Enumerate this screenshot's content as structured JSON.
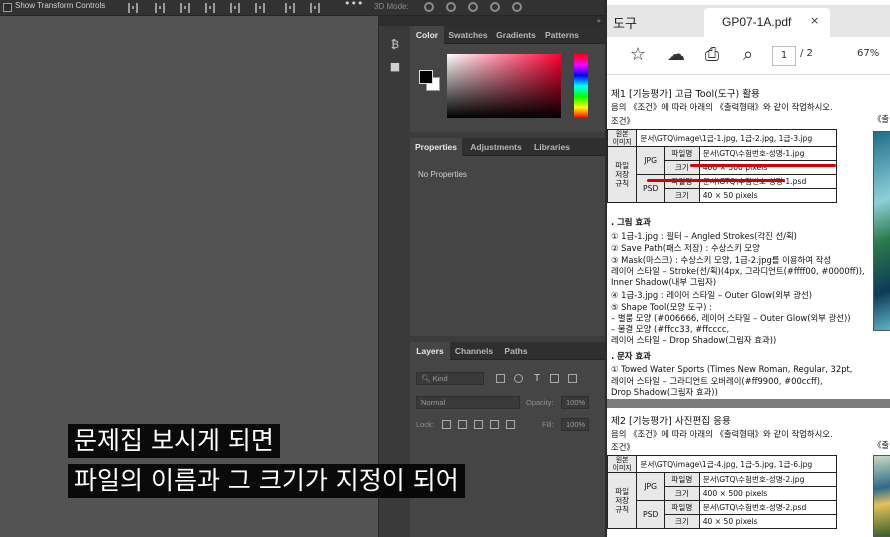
{
  "photoshop": {
    "options_bar": {
      "show_transform_label": "Show Transform Controls",
      "more": "•••",
      "mode_label": "3D Mode:"
    },
    "color_panel": {
      "tabs": [
        "Color",
        "Swatches",
        "Gradients",
        "Patterns"
      ],
      "foreground": "#000000",
      "background": "#ffffff"
    },
    "properties_panel": {
      "tabs": [
        "Properties",
        "Adjustments",
        "Libraries"
      ],
      "empty_text": "No Properties"
    },
    "layers_panel": {
      "tabs": [
        "Layers",
        "Channels",
        "Paths"
      ],
      "kind_label": "Kind",
      "blend_mode": "Normal",
      "opacity_label": "Opacity:",
      "opacity_value": "100%",
      "lock_label": "Lock:",
      "fill_label": "Fill:",
      "fill_value": "100%"
    }
  },
  "subtitles": {
    "line1": "문제집 보시게 되면",
    "line2": "파일의 이름과 그 크기가 지정이 되어"
  },
  "pdf_viewer": {
    "tool_tab": "도구",
    "doc_tab": "GP07-1A.pdf",
    "close": "×",
    "page_current": "1",
    "page_total": "/ 2",
    "zoom": "67%",
    "q1": {
      "title": "제1 [기능평가] 고급 Tool(도구) 활용",
      "instruction": "음의 《조건》에 따라 아래의 《출력형태》와 같이 작업하시오.",
      "right_label": "《출",
      "conditions_label": "조건》",
      "table": {
        "orig_label": "원본\n이미지",
        "orig_value": "문서\\GTQ\\image\\1급-1.jpg, 1급-2.jpg, 1급-3.jpg",
        "save_label": "파일\n저장\n규칙",
        "jpg_label": "JPG",
        "psd_label": "PSD",
        "name_label": "파일명",
        "size_label": "크기",
        "jpg_name": "문서\\GTQ\\수험번호-성명-1.jpg",
        "jpg_size": "400 × 500 pixels",
        "psd_name": "문서\\GTQ\\수험번호-성명-1.psd",
        "psd_size": "40 × 50 pixels"
      },
      "effects_title": ". 그림 효과",
      "effects": [
        "① 1급-1.jpg : 필터 – Angled Strokes(각진 선/획)",
        "② Save Path(패스 저장) : 수상스키 모양",
        "③ Mask(마스크) : 수상스키 모양, 1급-2.jpg를 이용하여 작성",
        "   레이어 스타일 – Stroke(선/획)(4px, 그라디언트(#ffff00, #0000ff)),",
        "   Inner Shadow(내부 그림자)",
        "④ 1급-3.jpg : 레이어 스타일 – Outer Glow(외부 광선)",
        "⑤ Shape Tool(모양 도구) :",
        "   – 별룸 모양 (#006666, 레이어 스타일 – Outer Glow(외부 광선))",
        "   – 물결 모양 (#ffcc33, #ffcccc,",
        "     레이어 스타일 – Drop Shadow(그림자 효과))"
      ],
      "text_title": ". 문자 효과",
      "text_effects": [
        "① Towed Water Sports (Times New Roman, Regular, 32pt,",
        "   레이어 스타일 – 그라디언트 오버레이(#ff9900, #00ccff),",
        "   Drop Shadow(그림자 효과))"
      ]
    },
    "q2": {
      "title": "제2 [기능평가] 사진편집 응용",
      "instruction": "음의 《조건》에 따라 아래의 《출력형태》와 같이 작업하시오.",
      "right_label": "《출",
      "conditions_label": "조건》",
      "table": {
        "orig_label": "원본\n이미지",
        "orig_value": "문서\\GTQ\\image\\1급-4.jpg, 1급-5.jpg, 1급-6.jpg",
        "save_label": "파일\n저장\n규칙",
        "jpg_label": "JPG",
        "psd_label": "PSD",
        "name_label": "파일명",
        "size_label": "크기",
        "jpg_name": "문서\\GTQ\\수험번호-성명-2.jpg",
        "jpg_size": "400 × 500 pixels",
        "psd_name": "문서\\GTQ\\수험번호-성명-2.psd",
        "psd_size": "40 × 50 pixels"
      }
    },
    "thumb1_label": "67%",
    "thumb2_label": "GP07"
  }
}
